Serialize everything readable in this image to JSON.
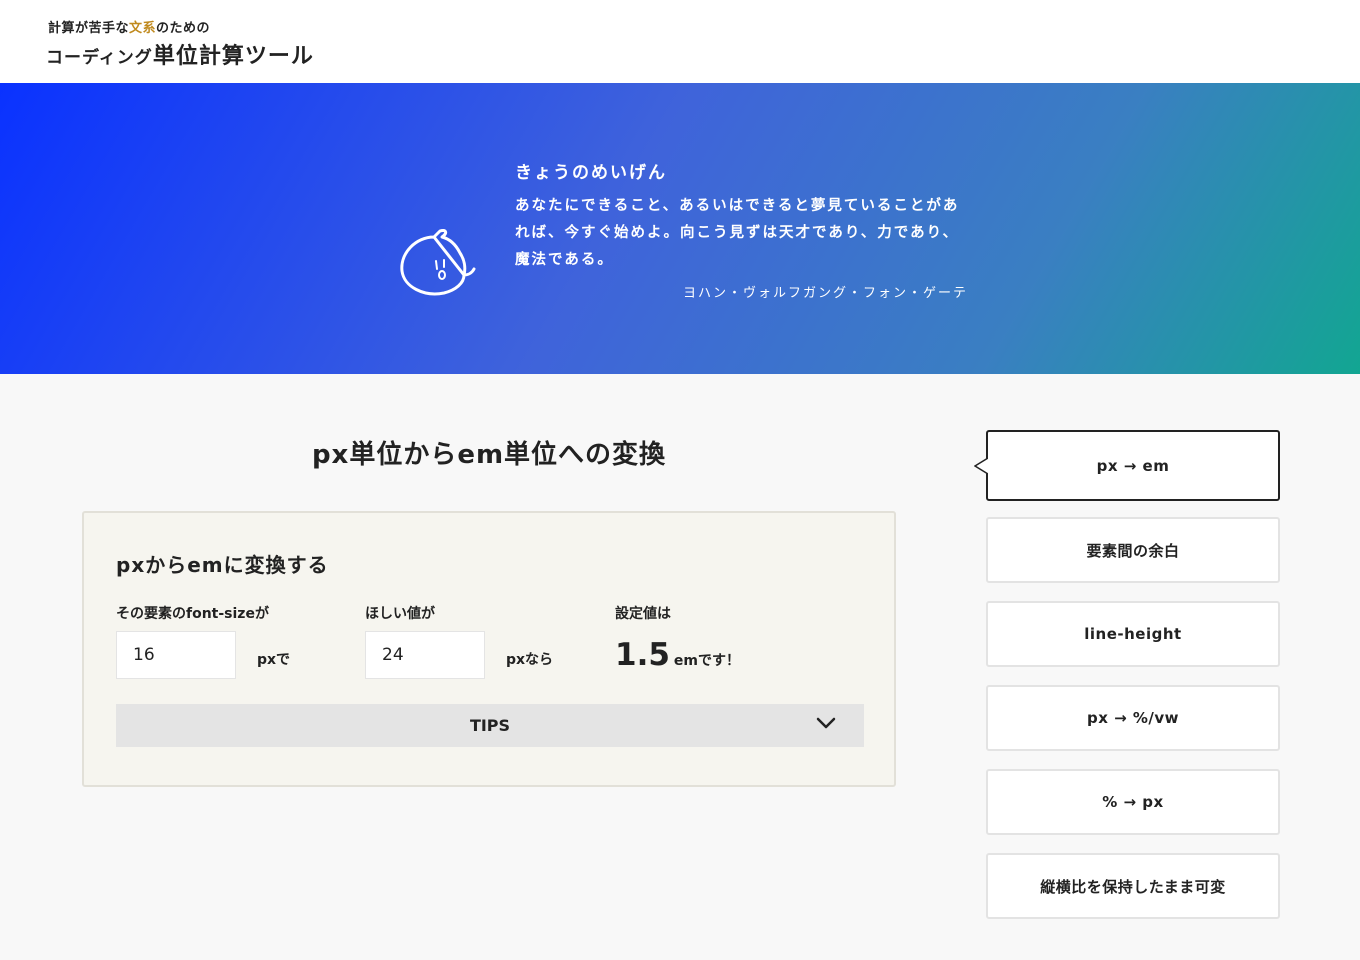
{
  "header": {
    "tagline_pre": "計算が苦手な",
    "tagline_accent": "文系",
    "tagline_post": "のための",
    "title_small": "コーディング",
    "title_main": "単位計算ツール",
    "accent_color": "#c08a1e"
  },
  "hero": {
    "mascot": "mascot-face-icon",
    "quote_title": "きょうのめいげん",
    "quote_text": "あなたにできること、あるいはできると夢見ていることがあれば、今すぐ始めよ。向こう見ずは天才であり、力であり、魔法である。",
    "author": "ヨハン・ヴォルフガング・フォン・ゲーテ",
    "gradient_colors": [
      "#0a32ff",
      "#3f63db",
      "#3a7fc2",
      "#12a692"
    ]
  },
  "main": {
    "heading": "px単位からem単位への変換",
    "card": {
      "title": "pxからemに変換する",
      "field1": {
        "label": "その要素のfont-sizeが",
        "value": "16",
        "unit": "pxで"
      },
      "field2": {
        "label": "ほしい値が",
        "value": "24",
        "unit": "pxなら"
      },
      "result": {
        "label": "設定値は",
        "value": "1.5",
        "suffix": "emです！"
      },
      "tips_label": "TIPS",
      "tips_icon": "chevron-down-icon"
    }
  },
  "sidebar": {
    "items": [
      {
        "label": "px → em",
        "active": true
      },
      {
        "label": "要素間の余白",
        "active": false
      },
      {
        "label": "line-height",
        "active": false
      },
      {
        "label": "px → %/vw",
        "active": false
      },
      {
        "label": "% → px",
        "active": false
      },
      {
        "label": "縦横比を保持したまま可変",
        "active": false
      }
    ]
  }
}
